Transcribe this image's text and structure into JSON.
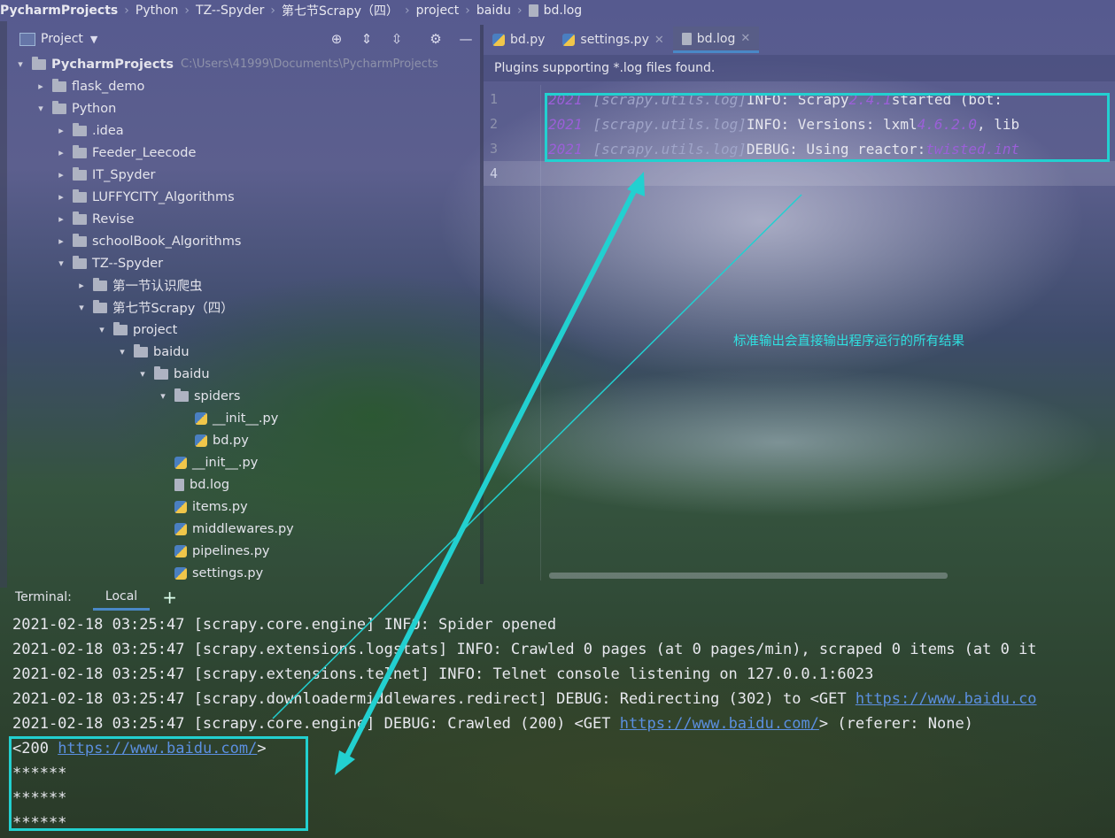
{
  "breadcrumb": [
    "PycharmProjects",
    "Python",
    "TZ--Spyder",
    "第七节Scrapy（四）",
    "project",
    "baidu",
    "bd.log"
  ],
  "project_panel": {
    "title": "Project",
    "icons": [
      "locate-icon",
      "expand-all-icon",
      "collapse-all-icon",
      "settings-icon",
      "minimize-icon"
    ]
  },
  "tree": [
    {
      "label": "PycharmProjects",
      "path": "C:\\Users\\41999\\Documents\\PycharmProjects",
      "indent": 0,
      "arrow": "▾",
      "kind": "folder",
      "bold": true
    },
    {
      "label": "flask_demo",
      "indent": 1,
      "arrow": "▸",
      "kind": "folder"
    },
    {
      "label": "Python",
      "indent": 1,
      "arrow": "▾",
      "kind": "folder"
    },
    {
      "label": ".idea",
      "indent": 2,
      "arrow": "▸",
      "kind": "folder"
    },
    {
      "label": "Feeder_Leecode",
      "indent": 2,
      "arrow": "▸",
      "kind": "folder"
    },
    {
      "label": "IT_Spyder",
      "indent": 2,
      "arrow": "▸",
      "kind": "folder"
    },
    {
      "label": "LUFFYCITY_Algorithms",
      "indent": 2,
      "arrow": "▸",
      "kind": "folder"
    },
    {
      "label": "Revise",
      "indent": 2,
      "arrow": "▸",
      "kind": "folder"
    },
    {
      "label": "schoolBook_Algorithms",
      "indent": 2,
      "arrow": "▸",
      "kind": "folder"
    },
    {
      "label": "TZ--Spyder",
      "indent": 2,
      "arrow": "▾",
      "kind": "folder"
    },
    {
      "label": "第一节认识爬虫",
      "indent": 3,
      "arrow": "▸",
      "kind": "folder"
    },
    {
      "label": "第七节Scrapy（四）",
      "indent": 3,
      "arrow": "▾",
      "kind": "folder"
    },
    {
      "label": "project",
      "indent": 4,
      "arrow": "▾",
      "kind": "folder"
    },
    {
      "label": "baidu",
      "indent": 5,
      "arrow": "▾",
      "kind": "folder"
    },
    {
      "label": "baidu",
      "indent": 6,
      "arrow": "▾",
      "kind": "folder"
    },
    {
      "label": "spiders",
      "indent": 7,
      "arrow": "▾",
      "kind": "folder"
    },
    {
      "label": "__init__.py",
      "indent": 8,
      "arrow": "",
      "kind": "py"
    },
    {
      "label": "bd.py",
      "indent": 8,
      "arrow": "",
      "kind": "py"
    },
    {
      "label": "__init__.py",
      "indent": 7,
      "arrow": "",
      "kind": "py"
    },
    {
      "label": "bd.log",
      "indent": 7,
      "arrow": "",
      "kind": "log"
    },
    {
      "label": "items.py",
      "indent": 7,
      "arrow": "",
      "kind": "py"
    },
    {
      "label": "middlewares.py",
      "indent": 7,
      "arrow": "",
      "kind": "py"
    },
    {
      "label": "pipelines.py",
      "indent": 7,
      "arrow": "",
      "kind": "py"
    },
    {
      "label": "settings.py",
      "indent": 7,
      "arrow": "",
      "kind": "py"
    }
  ],
  "editor": {
    "tabs": [
      {
        "label": "bd.py",
        "icon": "python-file-icon",
        "closable": false,
        "active": false
      },
      {
        "label": "settings.py",
        "icon": "python-file-icon",
        "closable": true,
        "active": false
      },
      {
        "label": "bd.log",
        "icon": "log-file-icon",
        "closable": true,
        "active": true
      }
    ],
    "banner": "Plugins supporting *.log files found.",
    "line_numbers": [
      "1",
      "2",
      "3",
      "4"
    ],
    "lines": [
      {
        "year": "2021",
        "logger": "[scrapy.utils.log]",
        "text": " INFO: Scrapy ",
        "value": "2.4.1",
        "rest": " started (bot: "
      },
      {
        "year": "2021",
        "logger": "[scrapy.utils.log]",
        "text": " INFO: Versions: lxml ",
        "value": "4.6.2.0",
        "rest": ", lib"
      },
      {
        "year": "2021",
        "logger": "[scrapy.utils.log]",
        "text": " DEBUG: Using reactor: ",
        "value": "twisted.int",
        "rest": ""
      },
      {
        "year": "",
        "logger": "",
        "text": "",
        "value": "",
        "rest": ""
      }
    ],
    "annotation": "标准输出会直接输出程序运行的所有结果"
  },
  "terminal": {
    "label": "Terminal:",
    "tab": "Local",
    "add": "+",
    "lines": [
      {
        "pre": "2021-02-18 03:25:47 [scrapy.core.engine] INFO: Spider opened",
        "link": "",
        "post": ""
      },
      {
        "pre": "2021-02-18 03:25:47 [scrapy.extensions.logstats] INFO: Crawled 0 pages (at 0 pages/min), scraped 0 items (at 0 it",
        "link": "",
        "post": ""
      },
      {
        "pre": "2021-02-18 03:25:47 [scrapy.extensions.telnet] INFO: Telnet console listening on 127.0.0.1:6023",
        "link": "",
        "post": ""
      },
      {
        "pre": "2021-02-18 03:25:47 [scrapy.downloadermiddlewares.redirect] DEBUG: Redirecting (302) to <GET ",
        "link": "https://www.baidu.co",
        "post": ""
      },
      {
        "pre": "2021-02-18 03:25:47 [scrapy.core.engine] DEBUG: Crawled (200) <GET ",
        "link": "https://www.baidu.com/",
        "post": "> (referer: None)"
      },
      {
        "pre": "<200 ",
        "link": "https://www.baidu.com/",
        "post": ">"
      },
      {
        "pre": "******",
        "link": "",
        "post": ""
      },
      {
        "pre": "******",
        "link": "",
        "post": ""
      },
      {
        "pre": "******",
        "link": "",
        "post": ""
      }
    ]
  },
  "colors": {
    "highlight": "#22d0d0",
    "accent": "#4a88c7",
    "link": "#5b8fe0"
  }
}
